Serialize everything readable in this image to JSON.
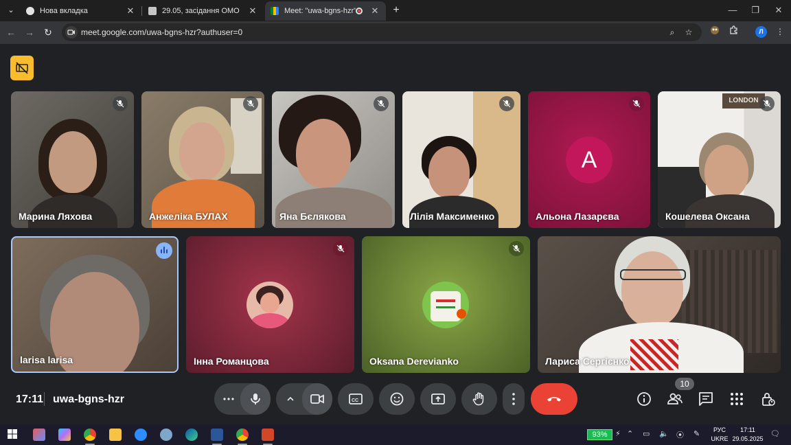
{
  "browser": {
    "tabs": [
      {
        "title": "Нова вкладка"
      },
      {
        "title": "29.05, засідання ОМО"
      },
      {
        "title": "Meet: \"uwa-bgns-hzr\""
      }
    ],
    "url": "meet.google.com/uwa-bgns-hzr?authuser=0",
    "profile_initial": "Л"
  },
  "meet": {
    "participants_row1": [
      {
        "name": "Марина Ляхова"
      },
      {
        "name": "Анжеліка БУЛАХ"
      },
      {
        "name": "Яна Бєлякова"
      },
      {
        "name": "Лілія Максименко"
      },
      {
        "name": "Альона Лазарєва",
        "avatar_letter": "A"
      },
      {
        "name": "Кошелева Оксана",
        "sign": "LONDON"
      }
    ],
    "participants_row2": [
      {
        "name": "larisa larisa"
      },
      {
        "name": "Інна Романцова"
      },
      {
        "name": "Oksana Derevianko"
      },
      {
        "name": "Лариса Сергієнко"
      }
    ],
    "time": "17:11",
    "meeting_code": "uwa-bgns-hzr",
    "participant_count": "10"
  },
  "taskbar": {
    "battery": "93%",
    "lang_top": "РУС",
    "lang_bottom": "UKRE",
    "time": "17:11",
    "date": "29.05.2025"
  },
  "colors": {
    "end_call": "#ea4335",
    "warning": "#f9bc2c",
    "speaking": "#8ab4f8"
  }
}
